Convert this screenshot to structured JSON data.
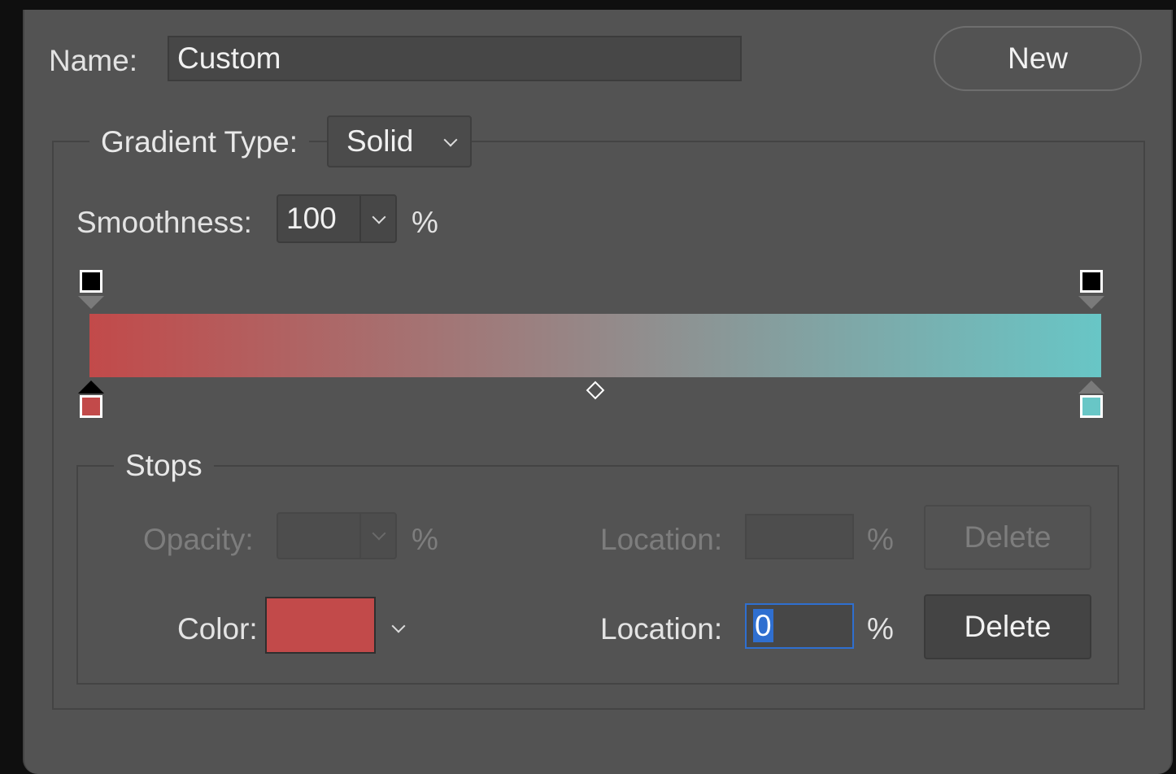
{
  "name": {
    "label": "Name:",
    "value": "Custom"
  },
  "new_button": "New",
  "gradient_type": {
    "label": "Gradient Type:",
    "value": "Solid"
  },
  "smoothness": {
    "label": "Smoothness:",
    "value": "100",
    "unit": "%"
  },
  "gradient": {
    "start_color": "#c24a4a",
    "end_color": "#68c6c6",
    "opacity_stop_color": "#000000",
    "midpoint_fraction": 0.5
  },
  "stops": {
    "title": "Stops",
    "opacity": {
      "label": "Opacity:",
      "value": "",
      "unit": "%"
    },
    "opacity_location": {
      "label": "Location:",
      "value": "",
      "unit": "%"
    },
    "opacity_delete": "Delete",
    "color": {
      "label": "Color:",
      "swatch": "#c24a4a"
    },
    "color_location": {
      "label": "Location:",
      "value": "0",
      "unit": "%"
    },
    "color_delete": "Delete"
  },
  "icons": {
    "dropdown": "chevron-down-icon",
    "midpoint": "diamond-icon"
  }
}
